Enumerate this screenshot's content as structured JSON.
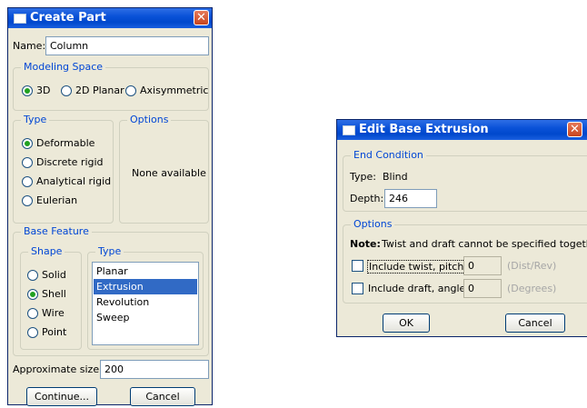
{
  "create_part": {
    "title": "Create Part",
    "close": "✕",
    "name_label": "Name:",
    "name_value": "Column",
    "modeling_space": {
      "title": "Modeling Space",
      "options": [
        "3D",
        "2D Planar",
        "Axisymmetric"
      ],
      "selected": "3D"
    },
    "type": {
      "title": "Type",
      "options": [
        "Deformable",
        "Discrete rigid",
        "Analytical rigid",
        "Eulerian"
      ],
      "selected": "Deformable"
    },
    "options": {
      "title": "Options",
      "text": "None available"
    },
    "base_feature": {
      "title": "Base Feature",
      "shape_title": "Shape",
      "shapes": [
        "Solid",
        "Shell",
        "Wire",
        "Point"
      ],
      "selected_shape": "Shell",
      "type_title": "Type",
      "types": [
        "Planar",
        "Extrusion",
        "Revolution",
        "Sweep"
      ],
      "selected_type": "Extrusion"
    },
    "approx_size_label": "Approximate size:",
    "approx_size_value": "200",
    "continue_label": "Continue...",
    "cancel_label": "Cancel"
  },
  "edit_extrusion": {
    "title": "Edit Base Extrusion",
    "close": "✕",
    "end_condition": {
      "title": "End Condition",
      "type_label": "Type:",
      "type_value": "Blind",
      "depth_label": "Depth:",
      "depth_value": "246"
    },
    "options": {
      "title": "Options",
      "note_bold": "Note:",
      "note_text": "Twist and draft cannot be specified together.",
      "twist_label": "Include twist, pitch:",
      "twist_value": "0",
      "twist_unit": "(Dist/Rev)",
      "draft_label": "Include draft, angle:",
      "draft_value": "0",
      "draft_unit": "(Degrees)"
    },
    "ok_label": "OK",
    "cancel_label": "Cancel"
  }
}
